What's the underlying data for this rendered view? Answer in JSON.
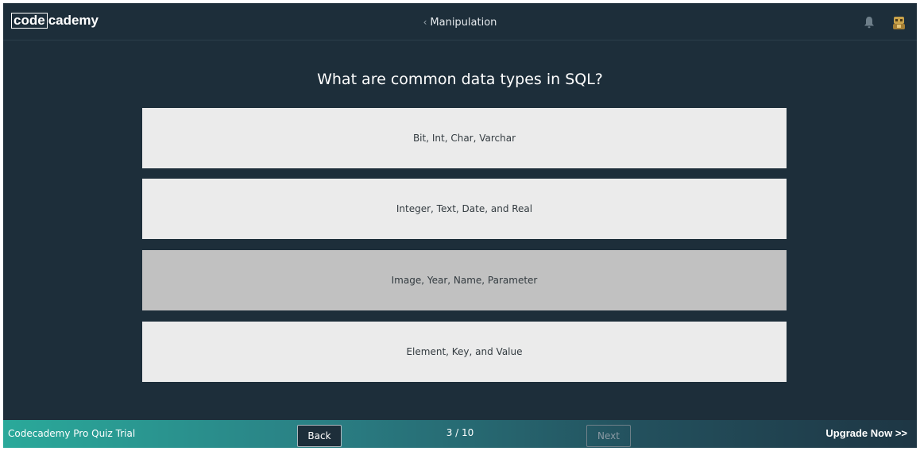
{
  "header": {
    "logo_part1": "code",
    "logo_part2": "cademy",
    "breadcrumb": "Manipulation",
    "breadcrumb_icon": "chevron-left-icon",
    "notification_icon": "bell-icon",
    "avatar_icon": "user-avatar-icon"
  },
  "quiz": {
    "question": "What are common data types in SQL?",
    "answers": [
      "Bit, Int, Char, Varchar",
      "Integer, Text, Date, and Real",
      "Image, Year, Name, Parameter",
      "Element, Key, and Value"
    ],
    "highlighted_answer_index": 2
  },
  "footer": {
    "trial_label": "Codecademy Pro Quiz Trial",
    "back_label": "Back",
    "progress": "3 / 10",
    "next_label": "Next",
    "upgrade_label": "Upgrade Now >>"
  },
  "colors": {
    "background": "#1d2e3a",
    "answer_bg": "#ebebeb",
    "answer_hover_bg": "#c1c1c1",
    "footer_gradient_start": "#2aa99a",
    "footer_gradient_end": "#1e3644"
  }
}
